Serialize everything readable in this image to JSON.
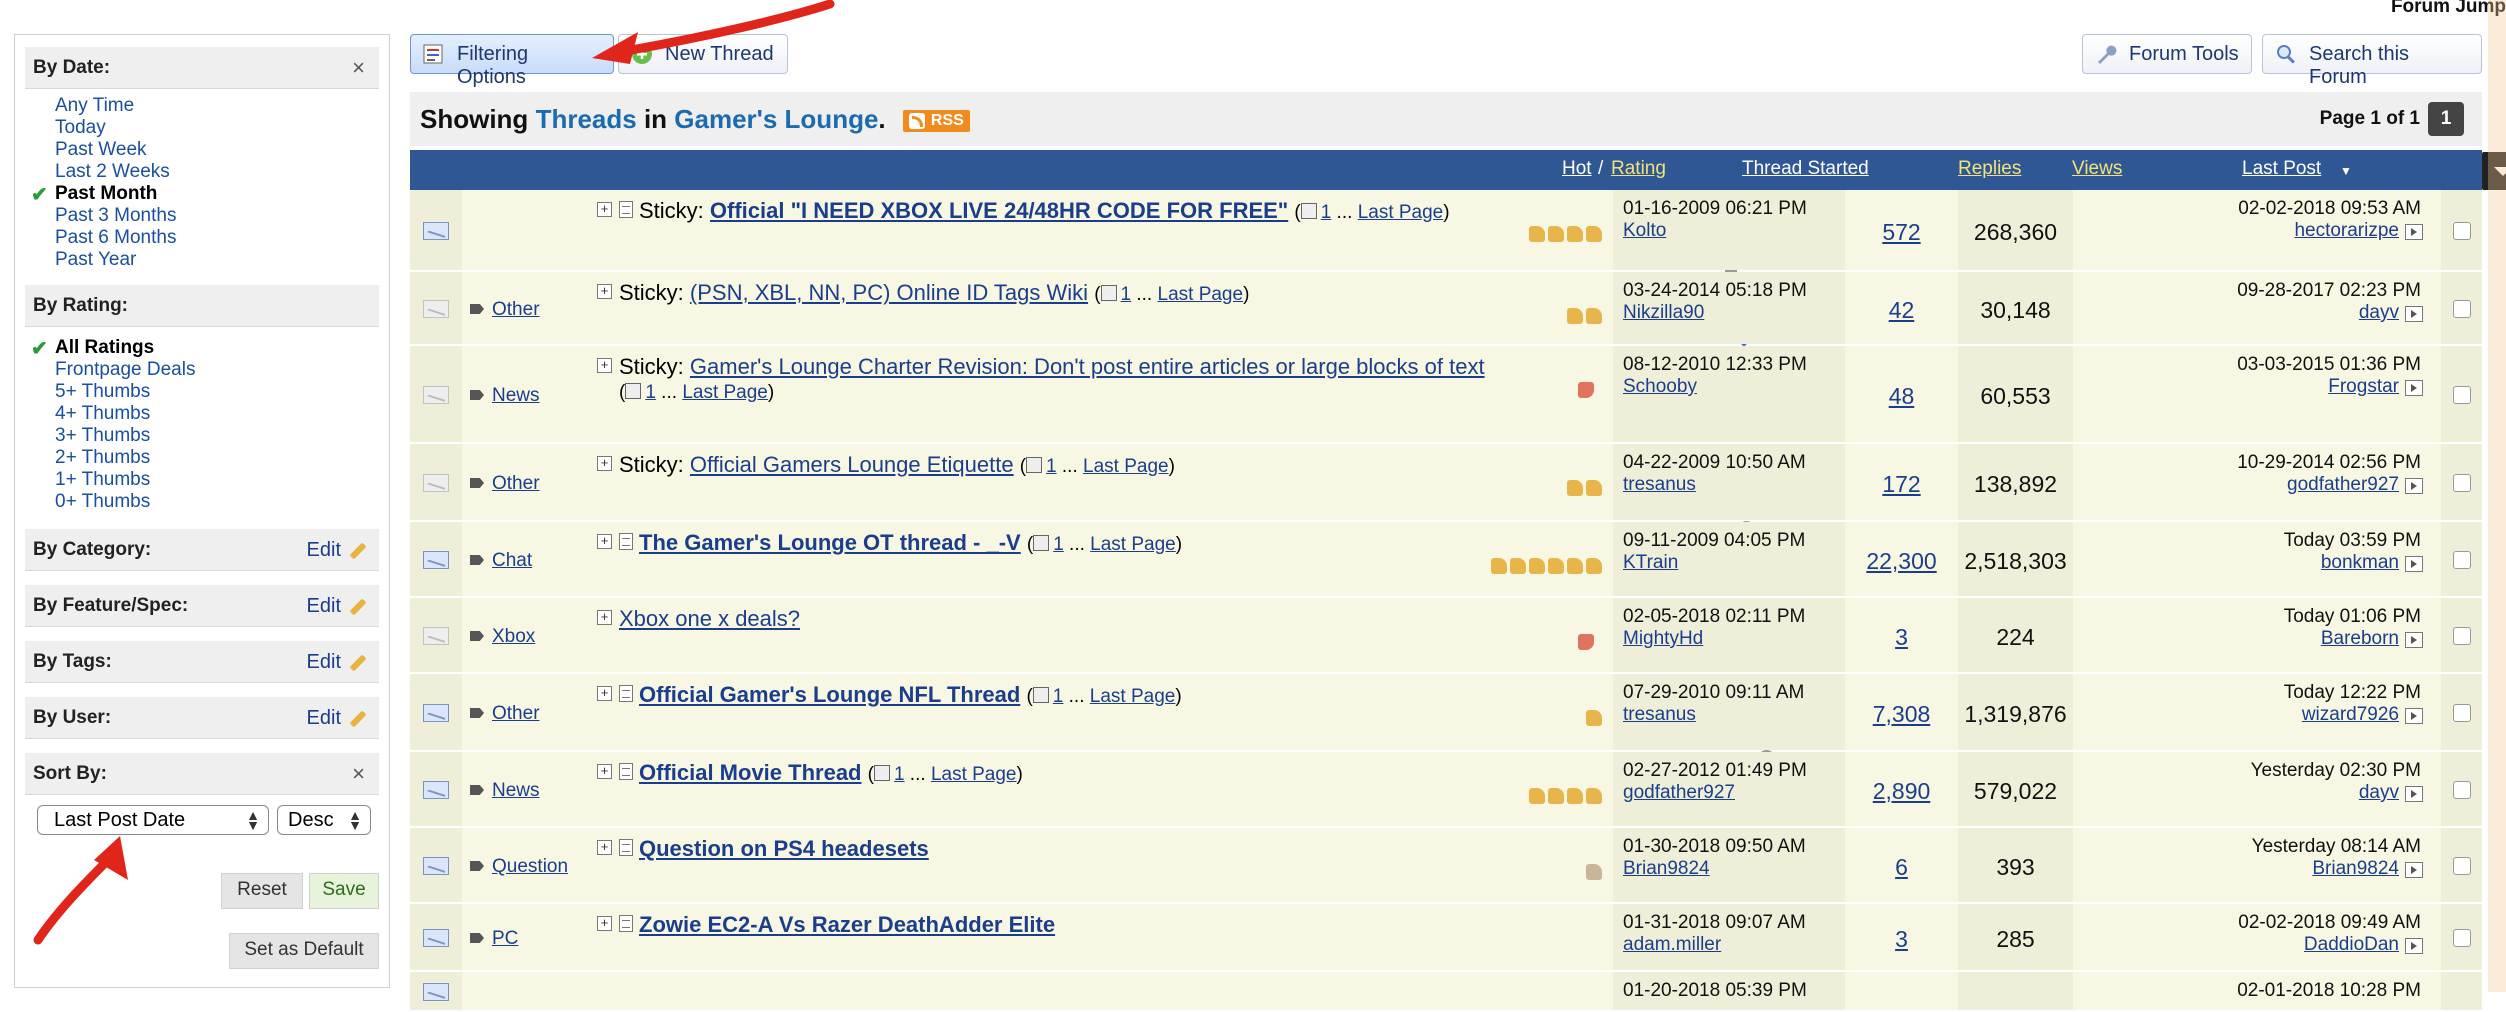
{
  "sidebar": {
    "by_date": {
      "label": "By Date:",
      "close": "×",
      "options": [
        "Any Time",
        "Today",
        "Past Week",
        "Last 2 Weeks",
        "Past Month",
        "Past 3 Months",
        "Past 6 Months",
        "Past Year"
      ],
      "selected": "Past Month"
    },
    "by_rating": {
      "label": "By Rating:",
      "options": [
        "All Ratings",
        "Frontpage Deals",
        "5+ Thumbs",
        "4+ Thumbs",
        "3+ Thumbs",
        "2+ Thumbs",
        "1+ Thumbs",
        "0+ Thumbs"
      ],
      "selected": "All Ratings"
    },
    "by_category": {
      "label": "By Category:",
      "edit": "Edit"
    },
    "by_feature": {
      "label": "By Feature/Spec:",
      "edit": "Edit"
    },
    "by_tags": {
      "label": "By Tags:",
      "edit": "Edit"
    },
    "by_user": {
      "label": "By User:",
      "edit": "Edit"
    },
    "sort_by": {
      "label": "Sort By:",
      "close": "×",
      "field": "Last Post Date",
      "order": "Desc"
    },
    "reset_label": "Reset",
    "save_label": "Save",
    "default_label": "Set as Default"
  },
  "toolbar": {
    "filter_label": "Filtering Options",
    "new_thread_label": "New Thread",
    "forum_tools_label": "Forum Tools",
    "search_forum_label": "Search this Forum",
    "forum_jump": "Forum Jump"
  },
  "showing": {
    "prefix": "Showing",
    "threads": "Threads",
    "in": "in",
    "forum": "Gamer's Lounge",
    "dot": ".",
    "rss": "RSS",
    "page_info": "Page 1 of 1",
    "page_num": "1"
  },
  "columns": {
    "hot": "Hot",
    "slash": "/",
    "rating": "Rating",
    "thread_started": "Thread Started",
    "replies": "Replies",
    "views": "Views",
    "last_post": "Last Post"
  },
  "threads": [
    {
      "prefix": "",
      "sticky": "Sticky:",
      "title": "Official \"I NEED XBOX LIVE 24/48HR CODE FOR FREE\"",
      "bold": true,
      "page": "1",
      "last_page": "Last Page",
      "started_date": "01-16-2009 06:21 PM",
      "started_by": "Kolto",
      "replies": "572",
      "views": "268,360",
      "last_time": "02-02-2018 09:53 AM",
      "last_user": "hectorarizpe"
    },
    {
      "prefix": "Other",
      "sticky": "Sticky:",
      "title": "(PSN, XBL, NN, PC) Online ID Tags Wiki",
      "bold": false,
      "page": "1",
      "last_page": "Last Page",
      "started_date": "03-24-2014 05:18 PM",
      "started_by": "Nikzilla90",
      "replies": "42",
      "views": "30,148",
      "last_time": "09-28-2017 02:23 PM",
      "last_user": "dayv"
    },
    {
      "prefix": "News",
      "sticky": "Sticky:",
      "title": "Gamer's Lounge Charter Revision: Don't post entire articles or large blocks of text",
      "bold": false,
      "page": "1",
      "last_page": "Last Page",
      "started_date": "08-12-2010 12:33 PM",
      "started_by": "Schooby",
      "replies": "48",
      "views": "60,553",
      "last_time": "03-03-2015 01:36 PM",
      "last_user": "Frogstar"
    },
    {
      "prefix": "Other",
      "sticky": "Sticky:",
      "title": "Official Gamers Lounge Etiquette",
      "bold": false,
      "page": "1",
      "last_page": "Last Page",
      "started_date": "04-22-2009 10:50 AM",
      "started_by": "tresanus",
      "replies": "172",
      "views": "138,892",
      "last_time": "10-29-2014 02:56 PM",
      "last_user": "godfather927"
    },
    {
      "prefix": "Chat",
      "sticky": "",
      "title": "The Gamer's Lounge OT thread - _-V",
      "bold": true,
      "page": "1",
      "last_page": "Last Page",
      "started_date": "09-11-2009 04:05 PM",
      "started_by": "KTrain",
      "replies": "22,300",
      "views": "2,518,303",
      "last_time": "Today 03:59 PM",
      "last_user": "bonkman"
    },
    {
      "prefix": "Xbox",
      "sticky": "",
      "title": "Xbox one x deals?",
      "bold": false,
      "page": "",
      "last_page": "",
      "started_date": "02-05-2018 02:11 PM",
      "started_by": "MightyHd",
      "replies": "3",
      "views": "224",
      "last_time": "Today 01:06 PM",
      "last_user": "Bareborn"
    },
    {
      "prefix": "Other",
      "sticky": "",
      "title": "Official Gamer's Lounge NFL Thread",
      "bold": true,
      "page": "1",
      "last_page": "Last Page",
      "started_date": "07-29-2010 09:11 AM",
      "started_by": "tresanus",
      "replies": "7,308",
      "views": "1,319,876",
      "last_time": "Today 12:22 PM",
      "last_user": "wizard7926"
    },
    {
      "prefix": "News",
      "sticky": "",
      "title": "Official Movie Thread",
      "bold": true,
      "page": "1",
      "last_page": "Last Page",
      "started_date": "02-27-2012 01:49 PM",
      "started_by": "godfather927",
      "replies": "2,890",
      "views": "579,022",
      "last_time": "Yesterday 02:30 PM",
      "last_user": "dayv"
    },
    {
      "prefix": "Question",
      "sticky": "",
      "title": "Question on PS4 headesets",
      "bold": true,
      "page": "",
      "last_page": "",
      "started_date": "01-30-2018 09:50 AM",
      "started_by": "Brian9824",
      "replies": "6",
      "views": "393",
      "last_time": "Yesterday 08:14 AM",
      "last_user": "Brian9824"
    },
    {
      "prefix": "PC",
      "sticky": "",
      "title": "Zowie EC2-A Vs Razer DeathAdder Elite",
      "bold": true,
      "page": "",
      "last_page": "",
      "started_date": "01-31-2018 09:07 AM",
      "started_by": "adam.miller",
      "replies": "3",
      "views": "285",
      "last_time": "02-02-2018 09:49 AM",
      "last_user": "DaddioDan"
    },
    {
      "prefix": "",
      "sticky": "",
      "title": "",
      "bold": false,
      "page": "",
      "last_page": "",
      "started_date": "01-20-2018 05:39 PM",
      "started_by": "",
      "replies": "",
      "views": "",
      "last_time": "02-01-2018 10:28 PM",
      "last_user": ""
    }
  ],
  "colors": {
    "header_blue": "#2f5793",
    "row_bg": "#f7f7e4",
    "link": "#1a3e8c",
    "accent_red": "#e0261b"
  }
}
